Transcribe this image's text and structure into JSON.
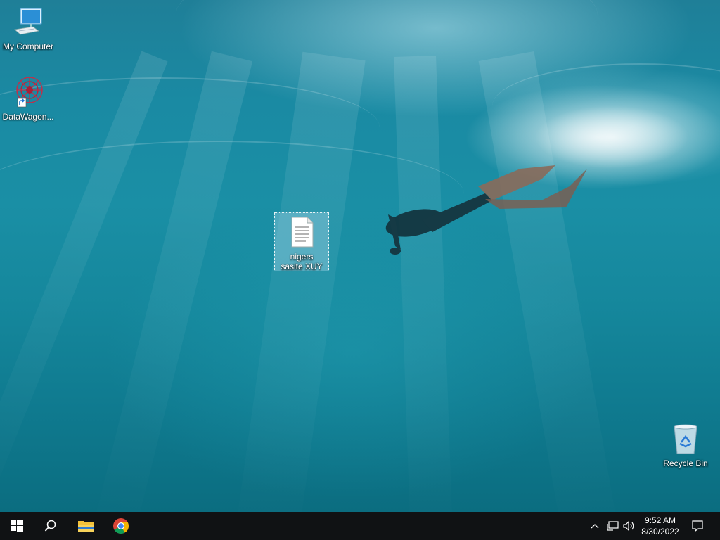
{
  "desktop": {
    "icons": [
      {
        "label": "My Computer",
        "icon": "computer-icon"
      },
      {
        "label": "DataWagon...",
        "icon": "datawagon-app-icon"
      },
      {
        "label": "nigers sasite XUY",
        "icon": "text-document-icon"
      },
      {
        "label": "Recycle Bin",
        "icon": "recycle-bin-icon"
      }
    ]
  },
  "taskbar": {
    "start": {
      "icon": "windows-logo-icon"
    },
    "search": {
      "icon": "search-icon"
    },
    "pinned": [
      {
        "name": "File Explorer",
        "icon": "folder-icon"
      },
      {
        "name": "Google Chrome",
        "icon": "chrome-icon"
      }
    ],
    "tray": {
      "icons": [
        "chevron-up-icon",
        "network-icon",
        "volume-icon"
      ],
      "time": "9:52 AM",
      "date": "8/30/2022",
      "notifications_icon": "action-center-icon"
    }
  },
  "colors": {
    "taskbar_bg": "#101214",
    "wallpaper_primary": "#1a8aa3",
    "folder_yellow": "#f3c13a"
  }
}
